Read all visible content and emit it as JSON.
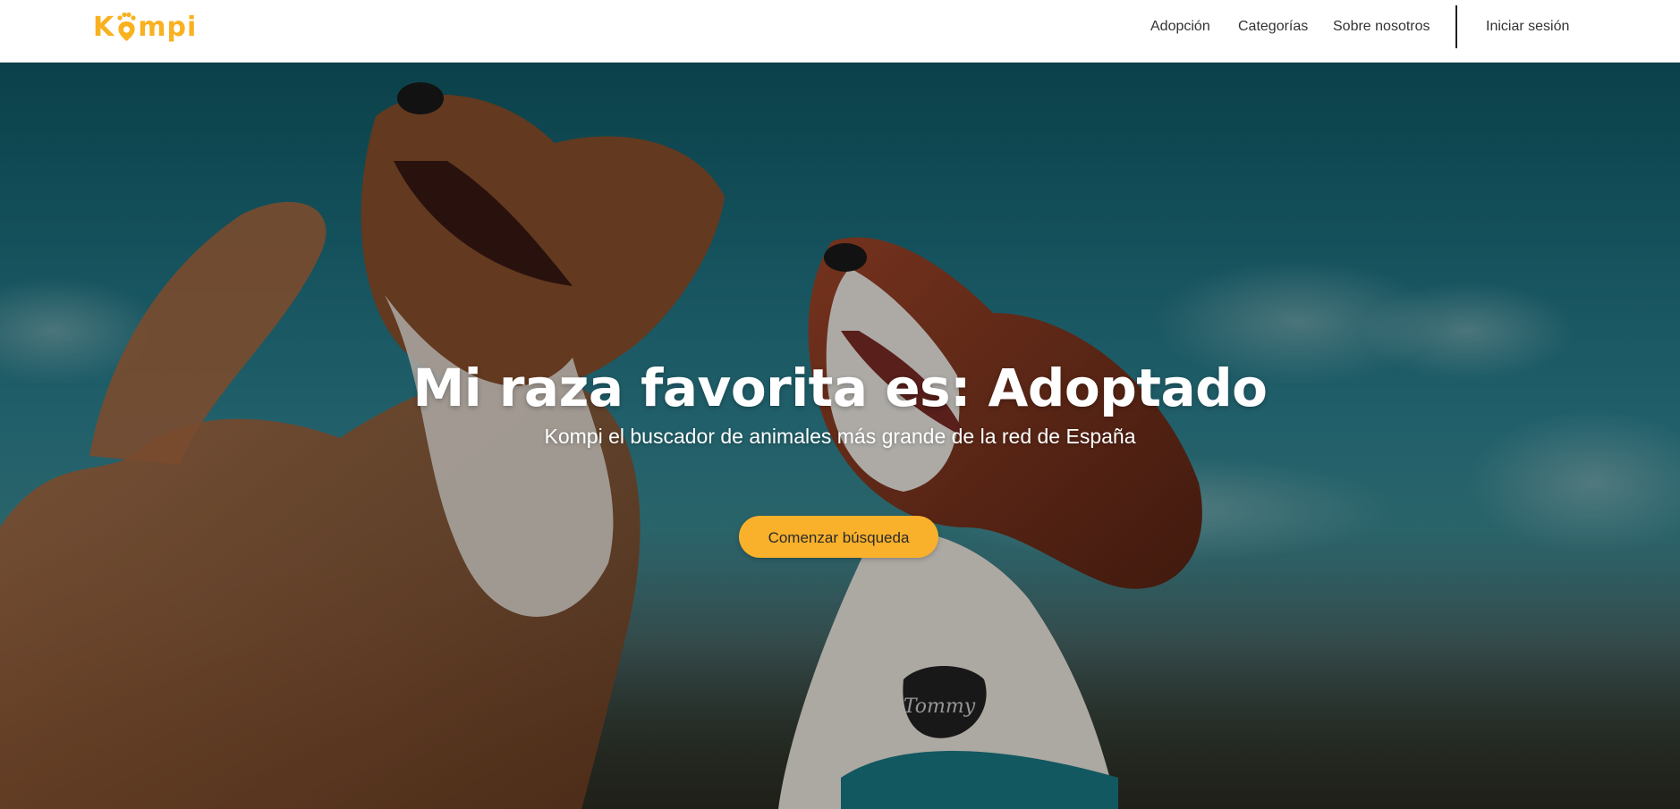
{
  "brand": {
    "logo_text_left": "K",
    "logo_text_right": "mpi",
    "logo_color": "#f9b11f",
    "logo_icon": "paw-pin-icon"
  },
  "nav": {
    "items": [
      {
        "label": "Adopción"
      },
      {
        "label": "Categorías"
      },
      {
        "label": "Sobre nosotros"
      }
    ],
    "login_label": "Iniciar sesión"
  },
  "hero": {
    "title": "Mi raza favorita es: Adoptado",
    "subtitle": "Kompi el buscador de animales más grande de la red de España",
    "cta_label": "Comenzar búsqueda",
    "cta_color": "#f9b12b",
    "background_image": "two-dogs-looking-up-sky-photo",
    "tag_text": "Tommy"
  }
}
